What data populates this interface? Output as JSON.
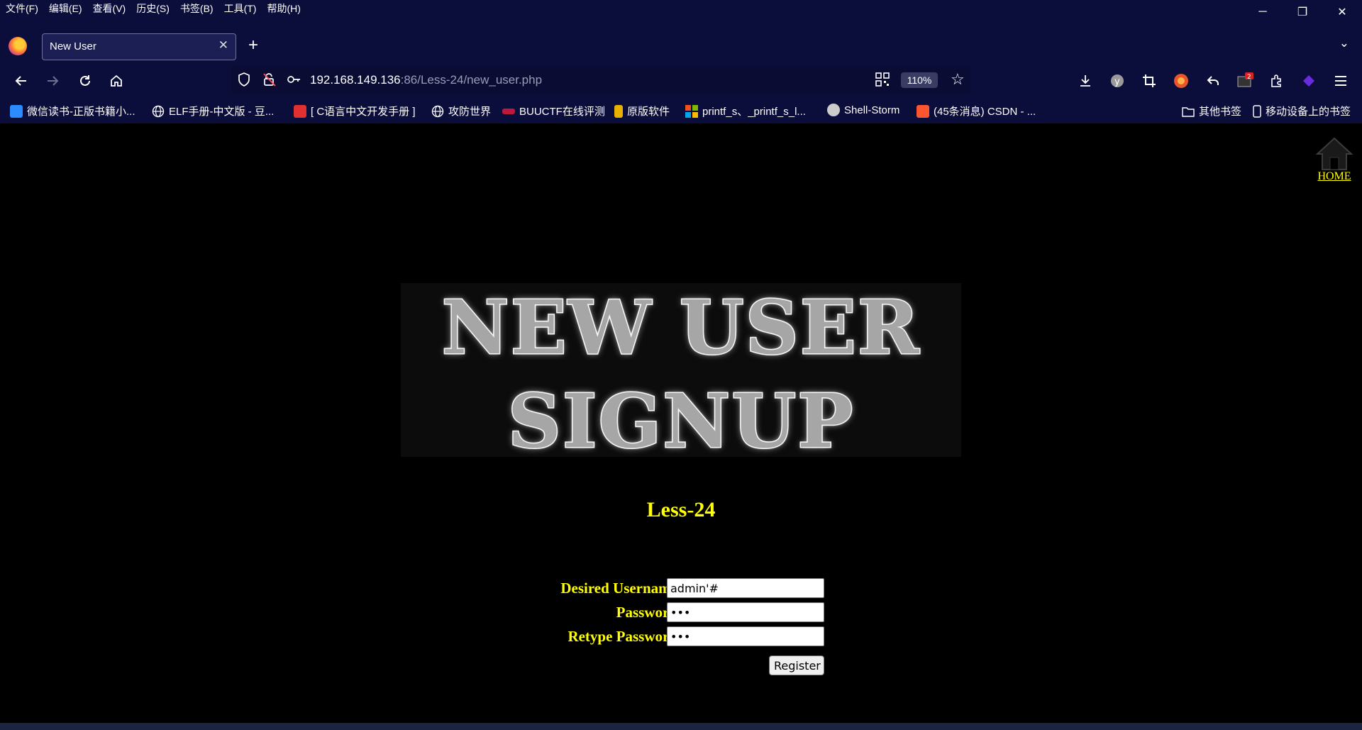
{
  "menubar": {
    "items": [
      "文件(F)",
      "编辑(E)",
      "查看(V)",
      "历史(S)",
      "书签(B)",
      "工具(T)",
      "帮助(H)"
    ]
  },
  "window_controls": {
    "minimize": "─",
    "restore": "❐",
    "close": "✕"
  },
  "tab": {
    "title": "New User",
    "close": "✕",
    "new_tab": "+",
    "list_all": "⌄"
  },
  "navbar": {
    "url_host": "192.168.149.136",
    "url_path": ":86/Less-24/new_user.php",
    "zoom": "110%"
  },
  "bookmarks": [
    {
      "label": "微信读书-正版书籍小...",
      "color": "#2a8cff"
    },
    {
      "label": "ELF手册-中文版 - 豆...",
      "color": "globe"
    },
    {
      "label": "[ C语言中文开发手册 ]",
      "color": "#e03030"
    },
    {
      "label": "攻防世界",
      "color": "globe"
    },
    {
      "label": "BUUCTF在线评测",
      "color": "#c0183a"
    },
    {
      "label": "原版软件",
      "color": "#e8b000"
    },
    {
      "label": "printf_s、_printf_s_l...",
      "color": "#f25022"
    },
    {
      "label": "Shell-Storm",
      "color": "#cccccc"
    },
    {
      "label": "(45条消息) CSDN - ...",
      "color": "#fc5531"
    }
  ],
  "bookmarks_right": {
    "other": "其他书签",
    "mobile": "移动设备上的书签"
  },
  "page": {
    "home_label": "HOME",
    "banner_line1": "NEW USER",
    "banner_line2": "SIGNUP",
    "level": "Less-24",
    "form": {
      "username_label": "Desired Username:",
      "username_value": "admin'#",
      "password_label": "Password:",
      "password_value": "aaa",
      "retype_label": "Retype Password:",
      "retype_value": "aaa",
      "submit": "Register"
    }
  },
  "colors": {
    "accent_text": "#ffff00",
    "chrome_bg": "#0b0e3a",
    "page_bg": "#000000"
  }
}
